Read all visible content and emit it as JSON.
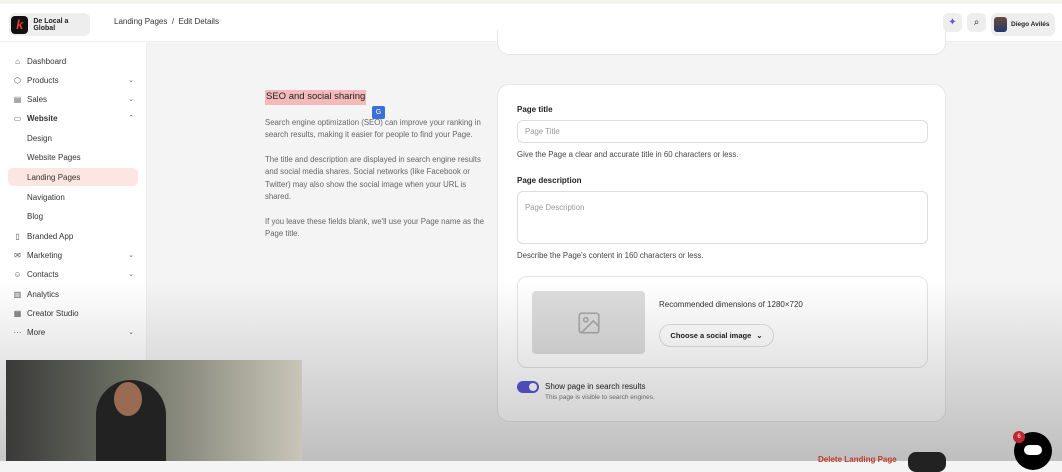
{
  "header": {
    "workspace": "De Local a Global",
    "breadcrumb": "Landing Pages  /  Edit Details",
    "user": "Diego Avilés"
  },
  "sidebar": {
    "items": [
      {
        "label": "Dashboard",
        "icon": "⌂"
      },
      {
        "label": "Products",
        "icon": "⬡",
        "chev": "⌄"
      },
      {
        "label": "Sales",
        "icon": "▤",
        "chev": "⌄"
      },
      {
        "label": "Website",
        "icon": "▭",
        "chev": "⌃"
      },
      {
        "label": "Design"
      },
      {
        "label": "Website Pages"
      },
      {
        "label": "Landing Pages"
      },
      {
        "label": "Navigation"
      },
      {
        "label": "Blog"
      },
      {
        "label": "Branded App",
        "icon": "▯"
      },
      {
        "label": "Marketing",
        "icon": "✉",
        "chev": "⌄"
      },
      {
        "label": "Contacts",
        "icon": "☺",
        "chev": "⌄"
      },
      {
        "label": "Analytics",
        "icon": "▥"
      },
      {
        "label": "Creator Studio",
        "icon": "▦"
      },
      {
        "label": "More",
        "icon": "···",
        "chev": "⌄"
      }
    ]
  },
  "seo": {
    "title": "SEO and social sharing",
    "p1": "Search engine optimization (SEO) can improve your ranking in search results, making it easier for people to find your Page.",
    "p2": "The title and description are displayed in search engine results and social media shares. Social networks (like Facebook or Twitter) may also show the social image when your URL is shared.",
    "p3": "If you leave these fields blank, we'll use your Page name as the Page title."
  },
  "form": {
    "page_title_label": "Page title",
    "page_title_placeholder": "Page Title",
    "page_title_help": "Give the Page a clear and accurate title in 60 characters or less.",
    "desc_label": "Page description",
    "desc_placeholder": "Page Description",
    "desc_help": "Describe the Page's content in 160 characters or less.",
    "image_rec": "Recommended dimensions of 1280×720",
    "image_button": "Choose a social image",
    "toggle_label": "Show page in search results",
    "toggle_sub": "This page is visible to search engines.",
    "toggle_on": true
  },
  "footer": {
    "delete": "Delete Landing Page",
    "badge": "6"
  }
}
